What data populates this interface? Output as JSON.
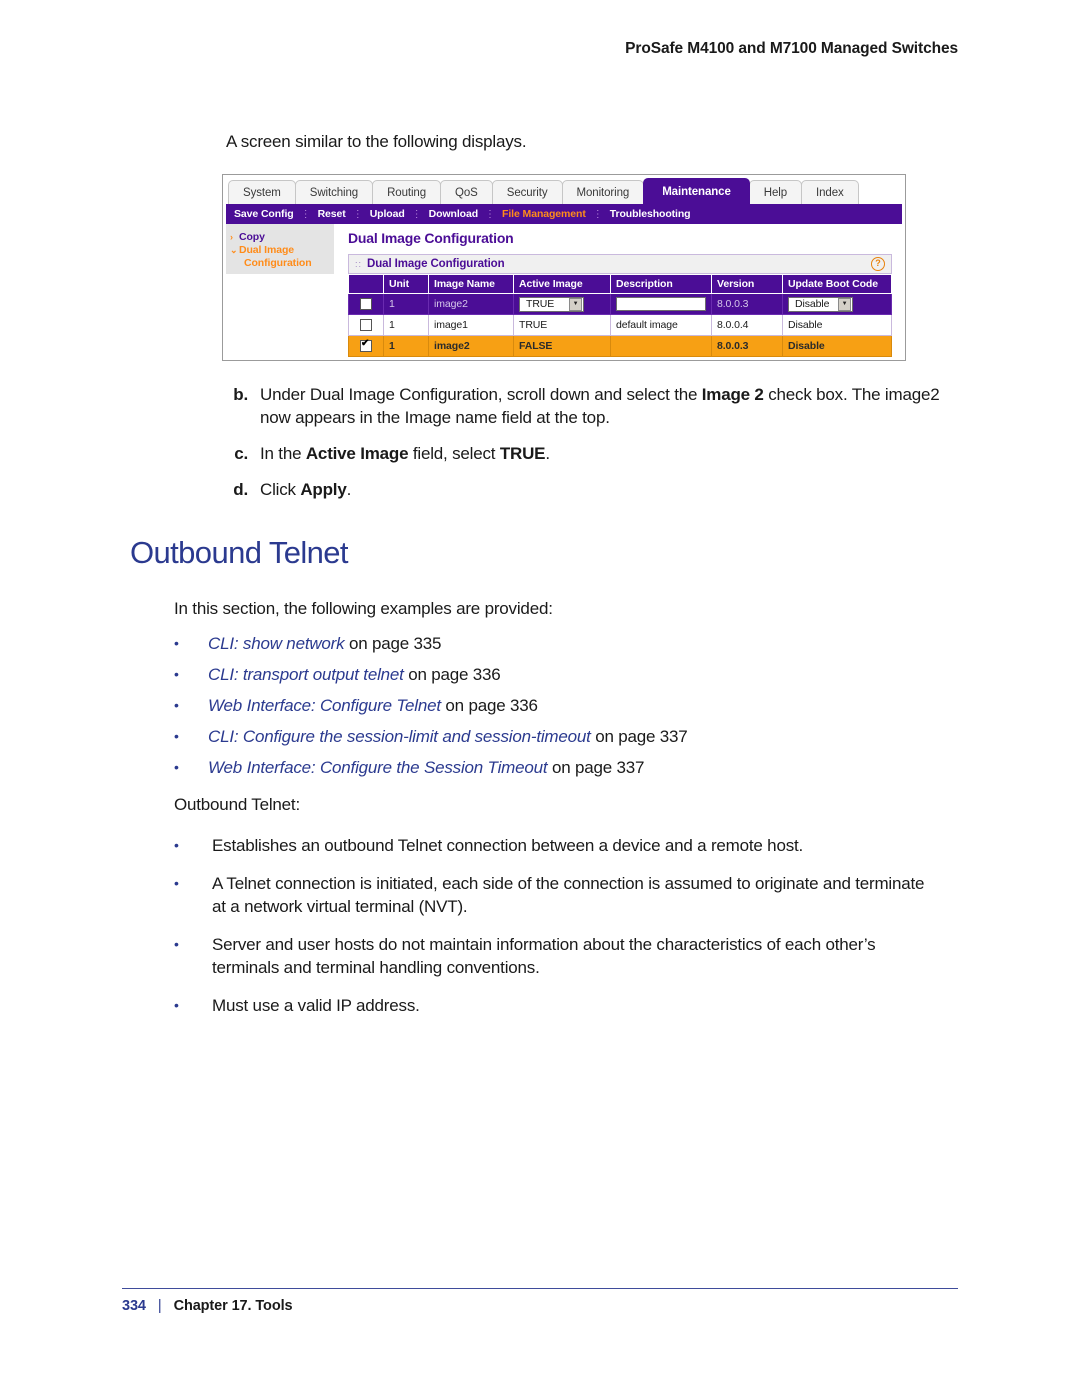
{
  "header": {
    "title": "ProSafe M4100 and M7100 Managed Switches"
  },
  "lead_text": "A screen similar to the following displays.",
  "screenshot": {
    "tabs": [
      {
        "label": "System",
        "active": false
      },
      {
        "label": "Switching",
        "active": false
      },
      {
        "label": "Routing",
        "active": false
      },
      {
        "label": "QoS",
        "active": false
      },
      {
        "label": "Security",
        "active": false
      },
      {
        "label": "Monitoring",
        "active": false
      },
      {
        "label": "Maintenance",
        "active": true
      },
      {
        "label": "Help",
        "active": false
      },
      {
        "label": "Index",
        "active": false
      }
    ],
    "subnav": [
      {
        "label": "Save Config",
        "current": false
      },
      {
        "label": "Reset",
        "current": false
      },
      {
        "label": "Upload",
        "current": false
      },
      {
        "label": "Download",
        "current": false
      },
      {
        "label": "File Management",
        "current": true
      },
      {
        "label": "Troubleshooting",
        "current": false
      }
    ],
    "sidebar": {
      "copy": "Copy",
      "dual_image": "Dual Image",
      "dual_image_sub": "Configuration",
      "chevron_copy": "›",
      "chevron_dual": "⌄"
    },
    "panel_title": "Dual Image Configuration",
    "panel_bar_title": "Dual Image Configuration",
    "help_icon_glyph": "?",
    "table": {
      "columns": [
        "",
        "Unit",
        "Image Name",
        "Active Image",
        "Description",
        "Version",
        "Update Boot Code"
      ],
      "rows": [
        {
          "style": "selected",
          "checked": false,
          "unit": "1",
          "image_name": "image2",
          "active_image": "TRUE",
          "active_image_control": "select",
          "description": "",
          "description_control": "textbox",
          "version": "8.0.0.3",
          "update_boot_code": "Disable",
          "update_boot_control": "select"
        },
        {
          "style": "plain",
          "checked": false,
          "unit": "1",
          "image_name": "image1",
          "active_image": "TRUE",
          "active_image_control": "text",
          "description": "default image",
          "description_control": "text",
          "version": "8.0.0.4",
          "update_boot_code": "Disable",
          "update_boot_control": "text"
        },
        {
          "style": "highlighted",
          "checked": true,
          "unit": "1",
          "image_name": "image2",
          "active_image": "FALSE",
          "active_image_control": "text",
          "description": "",
          "description_control": "text",
          "version": "8.0.0.3",
          "update_boot_code": "Disable",
          "update_boot_control": "text"
        }
      ]
    },
    "colors": {
      "purple": "#4b0d96",
      "orange": "#ff8c1a",
      "row_highlight": "#f7a014"
    }
  },
  "steps": [
    {
      "letter": "b.",
      "parts": [
        {
          "t": "Under Dual Image Configuration, scroll down and select the ",
          "b": false
        },
        {
          "t": "Image 2",
          "b": true
        },
        {
          "t": " check box. The image2 now appears in the Image name field at the top.",
          "b": false
        }
      ]
    },
    {
      "letter": "c.",
      "parts": [
        {
          "t": "In the ",
          "b": false
        },
        {
          "t": "Active Image",
          "b": true
        },
        {
          "t": " field, select ",
          "b": false
        },
        {
          "t": "TRUE",
          "b": true
        },
        {
          "t": ".",
          "b": false
        }
      ]
    },
    {
      "letter": "d.",
      "parts": [
        {
          "t": "Click ",
          "b": false
        },
        {
          "t": "Apply",
          "b": true
        },
        {
          "t": ".",
          "b": false
        }
      ]
    }
  ],
  "section": {
    "heading": "Outbound Telnet",
    "intro": "In this section, the following examples are provided:",
    "xrefs": [
      {
        "title": "CLI: show network",
        "suffix": " on page 335"
      },
      {
        "title": "CLI: transport output telnet",
        "suffix": " on page 336"
      },
      {
        "title": "Web Interface: Configure Telnet",
        "suffix": " on page 336"
      },
      {
        "title": "CLI: Configure the session-limit and session-timeout",
        "suffix": " on page 337"
      },
      {
        "title": "Web Interface: Configure the Session Timeout",
        "suffix": " on page 337"
      }
    ],
    "subintro": "Outbound Telnet:",
    "facts": [
      "Establishes an outbound Telnet connection between a device and a remote host.",
      "A Telnet connection is initiated, each side of the connection is assumed to originate and terminate at a network virtual terminal (NVT).",
      "Server and user hosts do not maintain information about the characteristics of each other’s terminals and terminal handling conventions.",
      "Must use a valid IP address."
    ],
    "bullet_glyph": "•"
  },
  "footer": {
    "page_number": "334",
    "separator": "|",
    "chapter": "Chapter 17. Tools"
  }
}
